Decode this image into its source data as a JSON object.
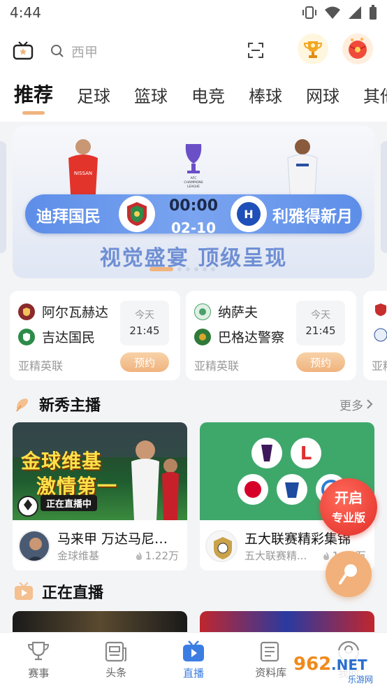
{
  "status": {
    "time": "4:44"
  },
  "topbar": {
    "search_placeholder": "西甲"
  },
  "tabs": [
    "推荐",
    "足球",
    "篮球",
    "电竞",
    "棒球",
    "网球",
    "其他"
  ],
  "banner": {
    "home": "迪拜国民",
    "away": "利雅得新月",
    "time": "00:00",
    "date": "02-10",
    "cup_label": "AFC CHAMPIONS LEAGUE ELITE",
    "slogan": "视觉盛宴 顶级呈现"
  },
  "matches": [
    {
      "home": "阿尔瓦赫达",
      "away": "吉达国民",
      "day": "今天",
      "time": "21:45",
      "league": "亚精英联",
      "button": "预约",
      "home_color": "#8b2a2a",
      "away_color": "#2e8b4a"
    },
    {
      "home": "纳萨夫",
      "away": "巴格达警察",
      "day": "今天",
      "time": "21:45",
      "league": "亚精英联",
      "button": "预约",
      "home_color": "#4aa06a",
      "away_color": "#d9a72b"
    }
  ],
  "match_peek": {
    "league": "亚精"
  },
  "rookie": {
    "title": "新秀主播",
    "more": "更多",
    "streams": [
      {
        "title": "马来甲 万达马尼沙...",
        "name": "金球维基",
        "views": "1.22万",
        "thumb_text1": "金球维基",
        "thumb_text2": "激情第一",
        "thumb_tag": "正在直播中"
      },
      {
        "title": "五大联赛精彩集锦",
        "name": "五大联赛精...",
        "views": "1.01万"
      }
    ]
  },
  "float_pro": {
    "line1": "开启",
    "line2": "专业版"
  },
  "live": {
    "title": "正在直播"
  },
  "nav": [
    {
      "label": "赛事",
      "icon": "trophy-icon"
    },
    {
      "label": "头条",
      "icon": "news-icon"
    },
    {
      "label": "直播",
      "icon": "live-play-icon"
    },
    {
      "label": "资料库",
      "icon": "database-icon"
    },
    {
      "label": "我的",
      "icon": "user-icon"
    }
  ],
  "watermark": {
    "brand": "962.NET",
    "sub": "乐游网"
  },
  "colors": {
    "accent": "#f0b37e",
    "nav_active": "#3b7de3",
    "banner_blue": "#5d8ee8",
    "pro_red": "#e22d28"
  }
}
